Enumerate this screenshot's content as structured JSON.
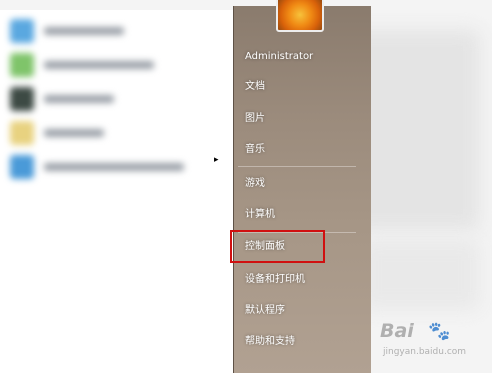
{
  "user_account": {
    "name": "Administrator"
  },
  "right_menu": {
    "documents": "文档",
    "pictures": "图片",
    "music": "音乐",
    "games": "游戏",
    "computer": "计算机",
    "control_panel": "控制面板",
    "devices_printers": "设备和打印机",
    "default_programs": "默认程序",
    "help_support": "帮助和支持"
  },
  "left_pane": {
    "all_programs_arrow": "▸"
  },
  "highlighted_item": "控制面板",
  "watermark": {
    "main": "Bai",
    "paw": "🐾",
    "sub": "jingyan.baidu.com"
  },
  "colors": {
    "right_pane": "#9b8b7c",
    "highlight_box": "#d01010",
    "menu_text": "#ffffff"
  }
}
